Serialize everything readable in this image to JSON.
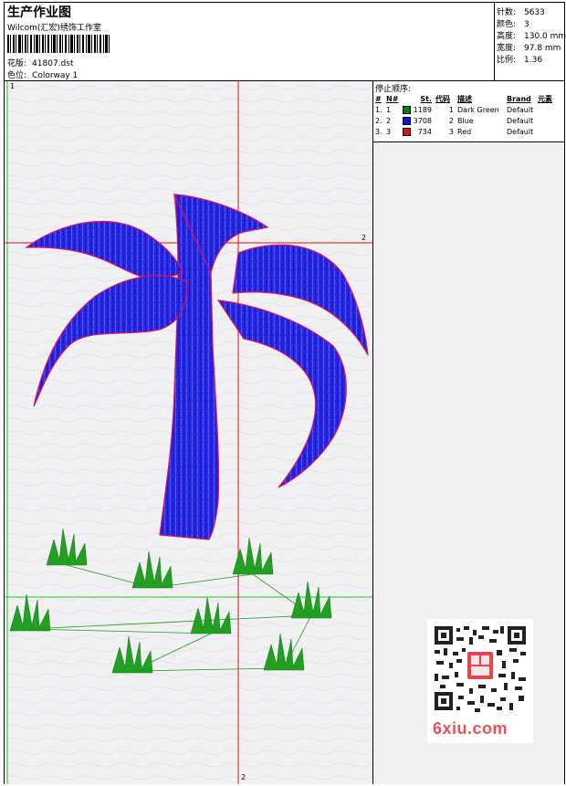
{
  "header": {
    "title": "生产作业图",
    "studio": "Wilcom(汇宏)绣饰工作室",
    "design_label": "花版:",
    "design_file": "41807.dst",
    "colorway_label": "色位:",
    "colorway": "Colorway 1"
  },
  "stats": [
    {
      "label": "针数:",
      "value": "5633"
    },
    {
      "label": "颜色:",
      "value": "3"
    },
    {
      "label": "高度:",
      "value": "130.0 mm"
    },
    {
      "label": "宽度:",
      "value": "97.8 mm"
    },
    {
      "label": "比例:",
      "value": "1.36"
    }
  ],
  "stop_sequence": {
    "title": "停止顺序:",
    "columns": [
      "#",
      "N#",
      "St.",
      "代码",
      "描述",
      "Brand",
      "元素"
    ],
    "rows": [
      {
        "num": "1.",
        "n": "1",
        "stitches": "1189",
        "code": "1",
        "desc": "Dark Green",
        "brand": "Default",
        "color": "#0a7d0a"
      },
      {
        "num": "2.",
        "n": "2",
        "stitches": "3708",
        "code": "2",
        "desc": "Blue",
        "brand": "Default",
        "color": "#1010ee"
      },
      {
        "num": "3.",
        "n": "3",
        "stitches": "734",
        "code": "3",
        "desc": "Red",
        "brand": "Default",
        "color": "#e01010"
      }
    ]
  },
  "markers": {
    "origin": "1",
    "h_axis": "2",
    "v_axis": "2"
  },
  "watermark": {
    "text": "6xiu.com"
  },
  "colors": {
    "palm": "#2323e6",
    "outline": "#e0105a",
    "grass": "#22a022",
    "axis": "#e01010",
    "guide": "#22cc22"
  }
}
